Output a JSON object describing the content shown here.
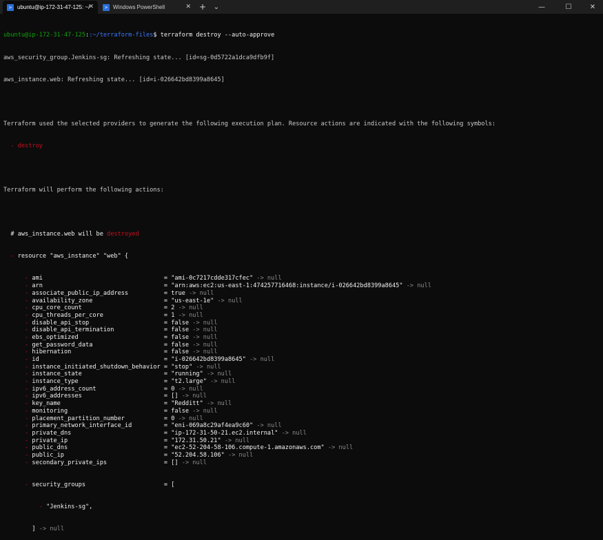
{
  "window": {
    "tabs": [
      {
        "title": "ubuntu@ip-172-31-47-125: ~/",
        "icon": "terminal-icon",
        "close": "✕"
      },
      {
        "title": "Windows PowerShell",
        "icon": "powershell-icon",
        "close": "✕"
      }
    ],
    "new_tab": "+",
    "dropdown": "⌄",
    "minimize": "—",
    "maximize": "☐",
    "close": "✕"
  },
  "terminal": {
    "prompt_user": "ubuntu@ip-172-31-47-125",
    "prompt_path": ":~/terraform-files",
    "prompt_symbol": "$ ",
    "command": "terraform destroy --auto-approve",
    "refresh_lines": [
      "aws_security_group.Jenkins-sg: Refreshing state... [id=sg-0d5722a1dca9dfb9f]",
      "aws_instance.web: Refreshing state... [id=i-026642bd8399a8645]"
    ],
    "plan_intro": "Terraform used the selected providers to generate the following execution plan. Resource actions are indicated with the following symbols:",
    "symbol_line": "  - destroy",
    "perform_line": "Terraform will perform the following actions:",
    "comment_prefix": "  # aws_instance.web will be ",
    "comment_status": "destroyed",
    "resource_prefix": "  - ",
    "resource_line": "resource \"aws_instance\" \"web\" {",
    "null_suffix": "-> null",
    "attr_indent": "      - ",
    "attributes": [
      {
        "name": "ami",
        "value": "\"ami-0c7217cdde317cfec\""
      },
      {
        "name": "arn",
        "value": "\"arn:aws:ec2:us-east-1:474257716468:instance/i-026642bd8399a8645\""
      },
      {
        "name": "associate_public_ip_address",
        "value": "true"
      },
      {
        "name": "availability_zone",
        "value": "\"us-east-1e\""
      },
      {
        "name": "cpu_core_count",
        "value": "2"
      },
      {
        "name": "cpu_threads_per_core",
        "value": "1"
      },
      {
        "name": "disable_api_stop",
        "value": "false"
      },
      {
        "name": "disable_api_termination",
        "value": "false"
      },
      {
        "name": "ebs_optimized",
        "value": "false"
      },
      {
        "name": "get_password_data",
        "value": "false"
      },
      {
        "name": "hibernation",
        "value": "false"
      },
      {
        "name": "id",
        "value": "\"i-026642bd8399a8645\""
      },
      {
        "name": "instance_initiated_shutdown_behavior",
        "value": "\"stop\""
      },
      {
        "name": "instance_state",
        "value": "\"running\""
      },
      {
        "name": "instance_type",
        "value": "\"t2.large\""
      },
      {
        "name": "ipv6_address_count",
        "value": "0"
      },
      {
        "name": "ipv6_addresses",
        "value": "[]"
      },
      {
        "name": "key_name",
        "value": "\"Redditt\""
      },
      {
        "name": "monitoring",
        "value": "false"
      },
      {
        "name": "placement_partition_number",
        "value": "0"
      },
      {
        "name": "primary_network_interface_id",
        "value": "\"eni-069a8c29af4ea9c60\""
      },
      {
        "name": "private_dns",
        "value": "\"ip-172-31-50-21.ec2.internal\""
      },
      {
        "name": "private_ip",
        "value": "\"172.31.50.21\""
      },
      {
        "name": "public_dns",
        "value": "\"ec2-52-204-58-106.compute-1.amazonaws.com\""
      },
      {
        "name": "public_ip",
        "value": "\"52.204.58.106\""
      },
      {
        "name": "secondary_private_ips",
        "value": "[]"
      }
    ],
    "security_groups_name": "security_groups",
    "security_groups_open": "[",
    "security_group_indent": "          - ",
    "security_group_item": "\"Jenkins-sg\",",
    "closing_indent": "        ",
    "closing_bracket": "]"
  }
}
